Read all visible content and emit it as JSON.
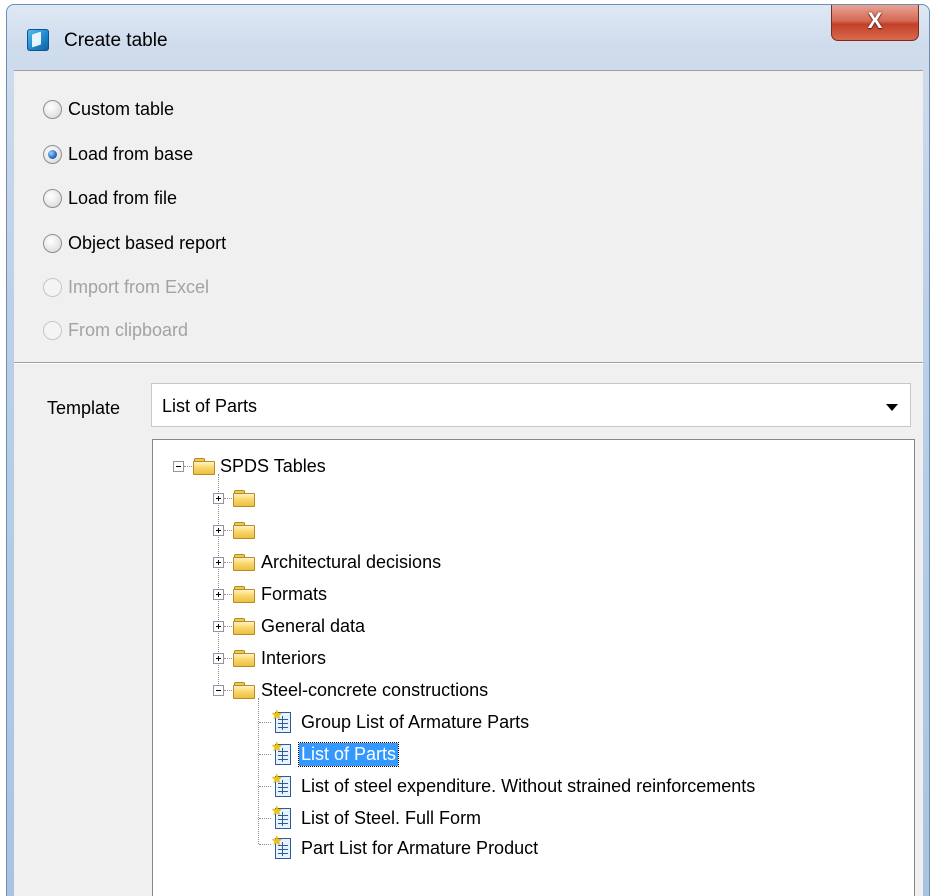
{
  "window": {
    "title": "Create table",
    "close_glyph": "X",
    "app_icon": "app-cube-icon"
  },
  "source_options": [
    {
      "label": "Custom table",
      "checked": false,
      "enabled": true
    },
    {
      "label": "Load from base",
      "checked": true,
      "enabled": true
    },
    {
      "label": "Load from file",
      "checked": false,
      "enabled": true
    },
    {
      "label": "Object based report",
      "checked": false,
      "enabled": true
    },
    {
      "label": "Import from Excel",
      "checked": false,
      "enabled": false
    },
    {
      "label": "From clipboard",
      "checked": false,
      "enabled": false
    }
  ],
  "template": {
    "label": "Template",
    "selected_value": "List of Parts"
  },
  "tree": {
    "root": "SPDS Tables",
    "folders": [
      {
        "label": "",
        "expanded": false
      },
      {
        "label": "",
        "expanded": false
      },
      {
        "label": "Architectural decisions",
        "expanded": false
      },
      {
        "label": "Formats",
        "expanded": false
      },
      {
        "label": "General data",
        "expanded": false
      },
      {
        "label": "Interiors",
        "expanded": false
      },
      {
        "label": "Steel-concrete constructions",
        "expanded": true
      }
    ],
    "items": [
      {
        "label": "Group List of Armature Parts",
        "selected": false
      },
      {
        "label": "List of Parts",
        "selected": true
      },
      {
        "label": "List of steel expenditure. Without strained reinforcements",
        "selected": false
      },
      {
        "label": "List of Steel. Full Form",
        "selected": false
      },
      {
        "label": "Part List for Armature Product",
        "selected": false
      }
    ]
  },
  "colors": {
    "selection": "#3399ff",
    "title_gradient_top": "#dfe9f5",
    "close_button": "#c4402a"
  }
}
